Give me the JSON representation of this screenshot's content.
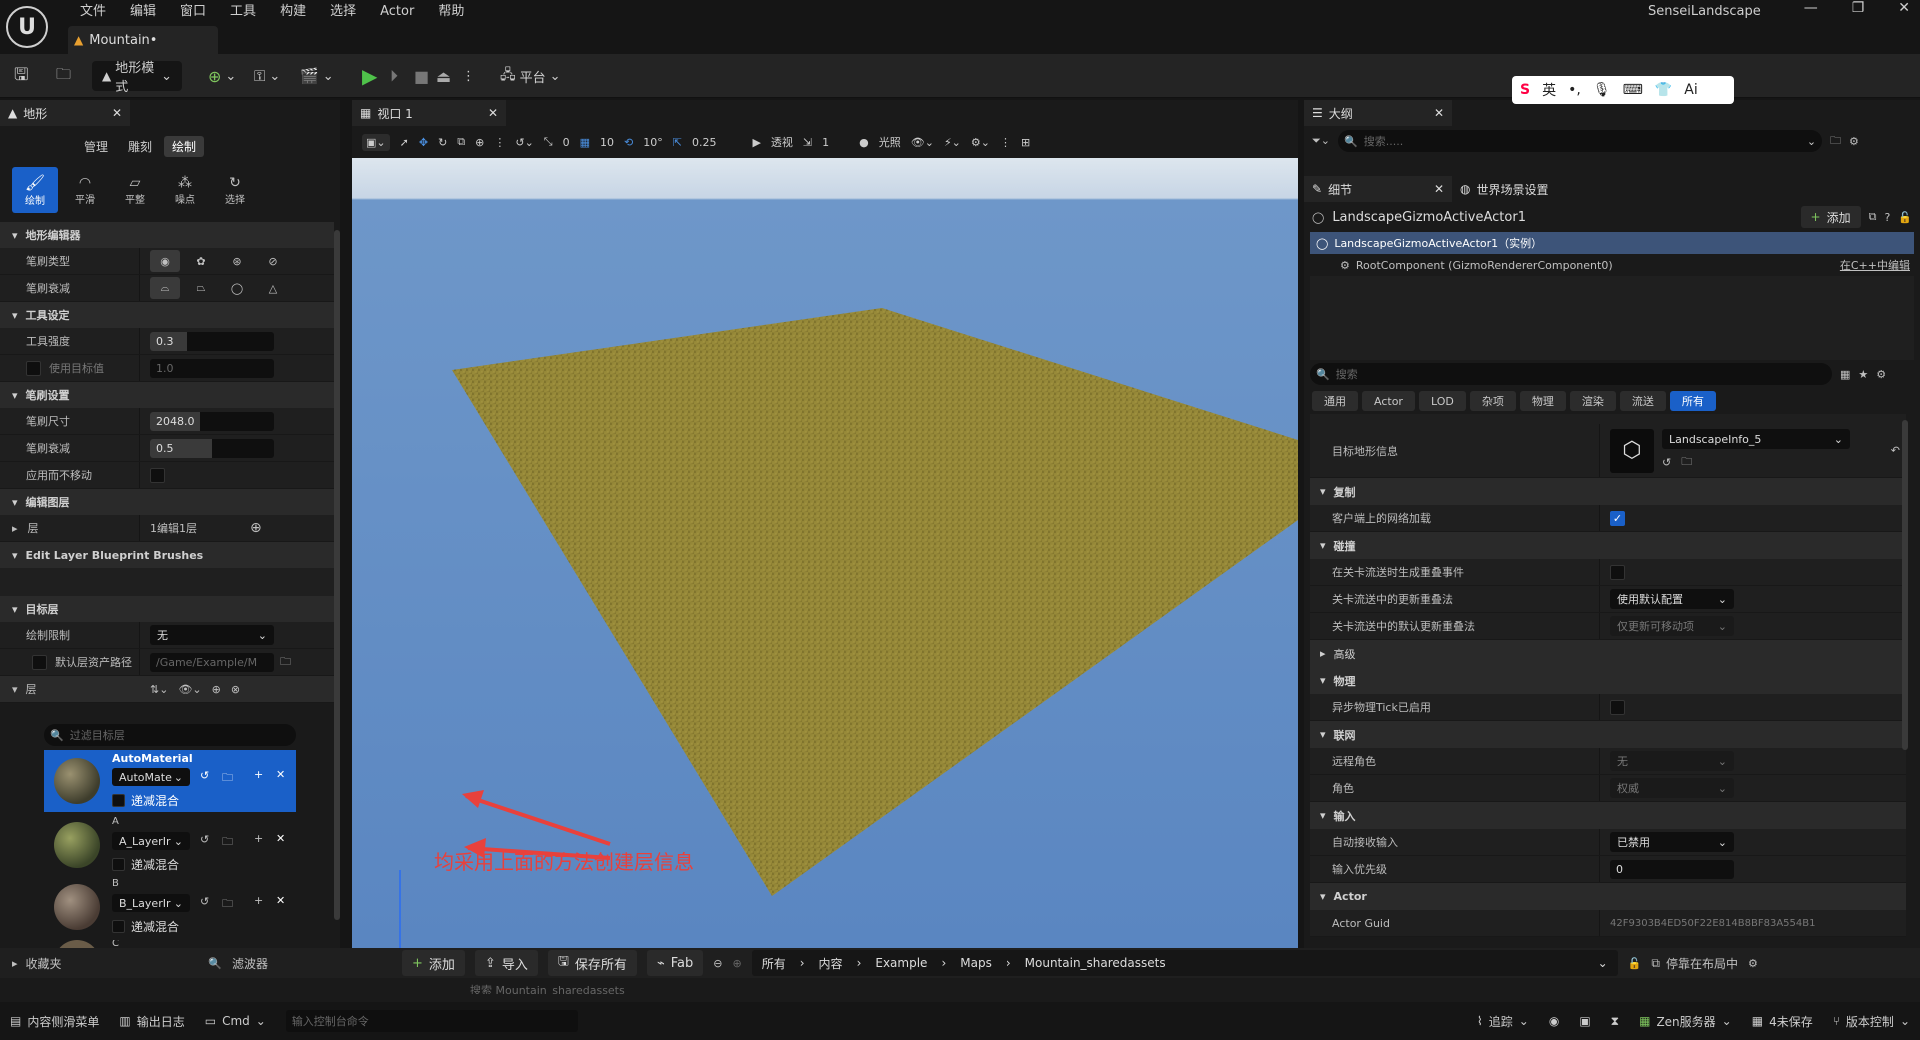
{
  "menu": [
    "文件",
    "编辑",
    "窗口",
    "工具",
    "构建",
    "选择",
    "Actor",
    "帮助"
  ],
  "doc_tab": "Mountain•",
  "project_name": "SenseiLandscape",
  "toolbar": {
    "mode": "地形模式",
    "platform": "平台"
  },
  "landscape_panel": {
    "tab": "地形",
    "modes": [
      "管理",
      "雕刻",
      "绘制"
    ],
    "tools": [
      "绘制",
      "平滑",
      "平整",
      "噪点",
      "选择"
    ],
    "sections": {
      "editor": "地形编辑器",
      "tool_settings": "工具设定",
      "brush_settings": "笔刷设置",
      "edit_layers": "编辑图层",
      "blueprint_brushes": "Edit Layer Blueprint Brushes",
      "target_layers": "目标层"
    },
    "brush_type_label": "笔刷类型",
    "brush_falloff_label": "笔刷衰减",
    "tool_strength_label": "工具强度",
    "tool_strength": "0.3",
    "use_target_label": "使用目标值",
    "use_target_value": "1.0",
    "brush_size_label": "笔刷尺寸",
    "brush_size": "2048.0",
    "brush_falloff2_label": "笔刷衰减",
    "brush_falloff": "0.5",
    "apply_no_move_label": "应用而不移动",
    "layers_label": "层",
    "layers_value": "1编辑1层",
    "paint_restrict_label": "绘制限制",
    "paint_restrict_value": "无",
    "default_path_label": "默认层资产路径",
    "default_path_value": "/Game/Example/M",
    "layer_label": "层",
    "filter_placeholder": "过滤目标层",
    "layer_items": [
      {
        "name": "AutoMaterial",
        "combo": "AutoMate",
        "blend": "递减混合"
      },
      {
        "name": "A",
        "combo": "A_LayerIr",
        "blend": "递减混合"
      },
      {
        "name": "B",
        "combo": "B_LayerIr",
        "blend": "递减混合"
      },
      {
        "name": "C"
      }
    ]
  },
  "viewport": {
    "tab": "视口 1",
    "snap_rot": "0",
    "grid": "10",
    "angle": "10°",
    "scale": "0.25",
    "perspective": "透视",
    "cams": "1",
    "lit": "光照"
  },
  "annotation": "均采用上面的方法创建层信息",
  "outliner": {
    "tab": "大纲",
    "search_placeholder": "搜索....."
  },
  "ime": {
    "lang": "英"
  },
  "details": {
    "tab": "细节",
    "world_tab": "世界场景设置",
    "actor_name": "LandscapeGizmoActiveActor1",
    "add": "添加",
    "instance_row": "LandscapeGizmoActiveActor1（实例）",
    "root_row": "RootComponent (GizmoRendererComponent0)",
    "edit_cpp": "在C++中编辑",
    "search_placeholder": "搜索",
    "filters": [
      "通用",
      "Actor",
      "LOD",
      "杂项",
      "物理",
      "渲染",
      "流送",
      "所有"
    ],
    "target_landscape_label": "目标地形信息",
    "target_landscape_value": "LandscapeInfo_5",
    "sections": {
      "replication": "复制",
      "collision": "碰撞",
      "advanced": "高级",
      "physics": "物理",
      "network": "联网",
      "input": "输入",
      "actor": "Actor"
    },
    "net_load_label": "客户端上的网络加载",
    "overlap_event_label": "在关卡流送时生成重叠事件",
    "update_overlap_label": "关卡流送中的更新重叠法",
    "update_overlap_value": "使用默认配置",
    "default_update_label": "关卡流送中的默认更新重叠法",
    "default_update_value": "仅更新可移动项",
    "async_tick_label": "异步物理Tick已启用",
    "remote_role_label": "远程角色",
    "remote_role_value": "无",
    "role_label": "角色",
    "role_value": "权威",
    "auto_input_label": "自动接收输入",
    "auto_input_value": "已禁用",
    "input_priority_label": "输入优先级",
    "input_priority_value": "0",
    "guid_label": "Actor Guid",
    "guid_value": "42F9303B4ED50F22E814B8BF83A554B1"
  },
  "content_bar": {
    "favorites": "收藏夹",
    "filter": "滤波器",
    "add": "添加",
    "import": "导入",
    "save_all": "保存所有",
    "fab": "Fab",
    "path": [
      "所有",
      "内容",
      "Example",
      "Maps",
      "Mountain_sharedassets"
    ],
    "dock": "停靠在布局中",
    "search_placeholder": "搜索 Mountain_sharedassets"
  },
  "status": {
    "drawer": "内容侧滑菜单",
    "log": "输出日志",
    "cmd": "Cmd",
    "console_placeholder": "输入控制台命令",
    "trace": "追踪",
    "zen": "Zen服务器",
    "unsaved": "4未保存",
    "vcs": "版本控制"
  },
  "colors": {
    "accent": "#1a60c8",
    "sky": "#6e97c9",
    "ground": "#8a7f30",
    "annotation": "#e8413c"
  }
}
